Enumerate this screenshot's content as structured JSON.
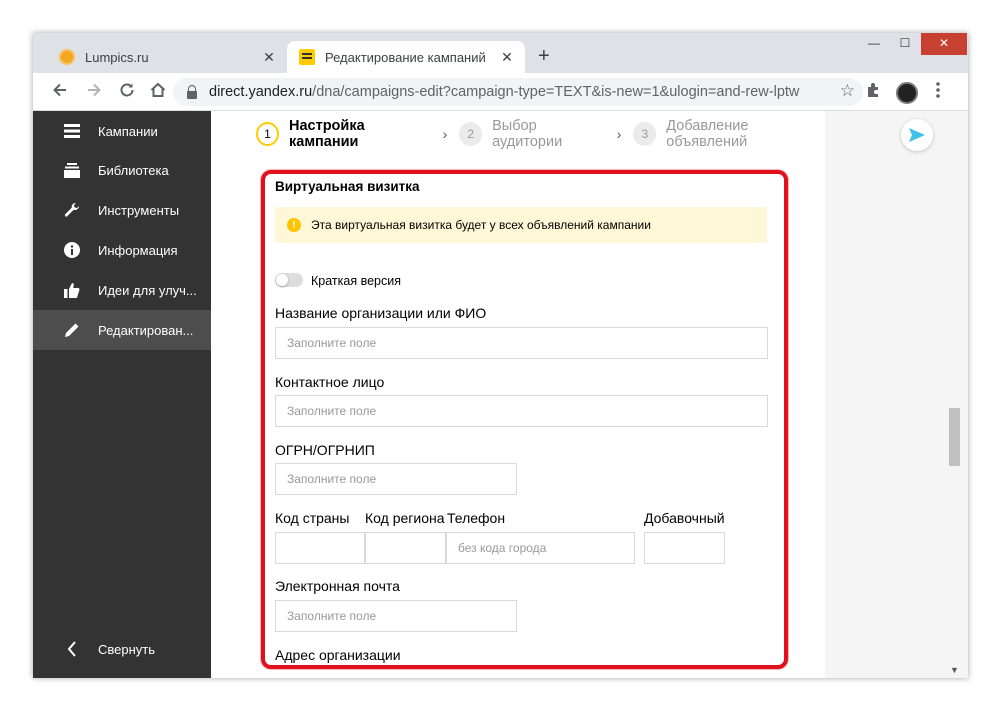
{
  "browser": {
    "tabs": [
      {
        "title": "Lumpics.ru",
        "close": "✕"
      },
      {
        "title": "Редактирование кампаний",
        "close": "✕"
      }
    ],
    "new_tab": "+",
    "window_controls": {
      "minimize": "—",
      "maximize": "☐",
      "close": "✕"
    },
    "url_host": "direct.yandex.ru",
    "url_path": "/dna/campaigns-edit?campaign-type=TEXT&is-new=1&ulogin=and-rew-lptw"
  },
  "sidebar": {
    "items": [
      {
        "label": "Кампании",
        "icon": "campaigns-icon"
      },
      {
        "label": "Библиотека",
        "icon": "library-icon"
      },
      {
        "label": "Инструменты",
        "icon": "wrench-icon"
      },
      {
        "label": "Информация",
        "icon": "info-icon"
      },
      {
        "label": "Идеи для улуч...",
        "icon": "thumbs-up-icon"
      },
      {
        "label": "Редактирован...",
        "icon": "pencil-icon",
        "active": true
      }
    ],
    "collapse_label": "Свернуть"
  },
  "steps": [
    {
      "num": "1",
      "label": "Настройка кампании",
      "active": true
    },
    {
      "num": "2",
      "label": "Выбор аудитории",
      "active": false
    },
    {
      "num": "3",
      "label": "Добавление объявлений",
      "active": false
    }
  ],
  "vcard": {
    "title": "Виртуальная визитка",
    "notice": "Эта виртуальная визитка будет у всех объявлений кампании",
    "short_version_label": "Краткая версия",
    "org_name_label": "Название организации или ФИО",
    "contact_label": "Контактное лицо",
    "ogrn_label": "ОГРН/ОГРНИП",
    "country_code_label": "Код страны",
    "region_code_label": "Код региона",
    "phone_label": "Телефон",
    "ext_label": "Добавочный",
    "email_label": "Электронная почта",
    "address_label": "Адрес организации",
    "placeholder_fill": "Заполните поле",
    "placeholder_phone": "без кода города"
  },
  "colors": {
    "accent": "#ffcc00",
    "highlight": "#e0101d",
    "sidebar_bg": "#333333"
  }
}
